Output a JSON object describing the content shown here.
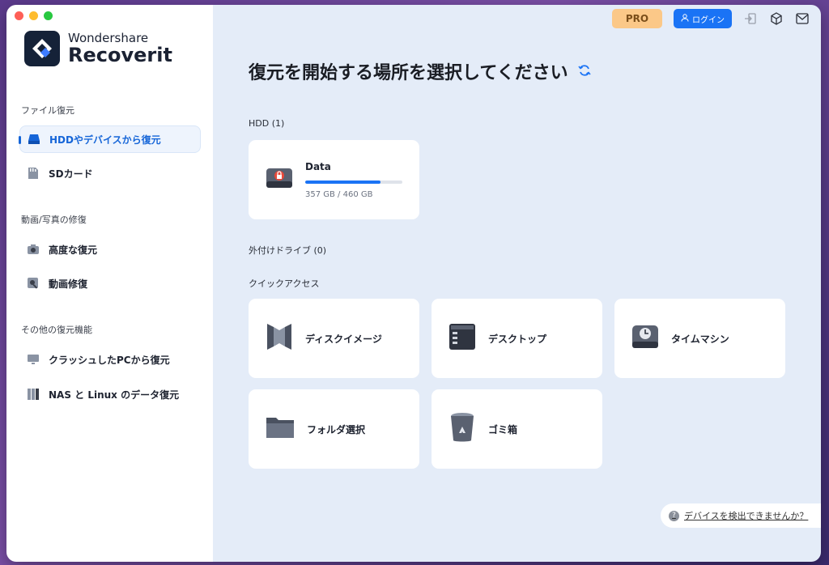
{
  "brand": {
    "line1": "Wondershare",
    "line2": "Recoverit"
  },
  "sidebar": {
    "sections": [
      {
        "title": "ファイル復元"
      },
      {
        "title": "動画/写真の修復"
      },
      {
        "title": "その他の復元機能"
      }
    ],
    "items": [
      {
        "label": "HDDやデバイスから復元",
        "icon": "hdd-icon",
        "active": true
      },
      {
        "label": "SDカード",
        "icon": "sd-card-icon"
      },
      {
        "label": "高度な復元",
        "icon": "camera-icon"
      },
      {
        "label": "動画修復",
        "icon": "video-repair-icon"
      },
      {
        "label": "クラッシュしたPCから復元",
        "icon": "monitor-icon"
      },
      {
        "label": "NAS と Linux のデータ復元",
        "icon": "nas-icon"
      }
    ]
  },
  "topbar": {
    "pro_label": "PRO",
    "login_label": "ログイン"
  },
  "main": {
    "title": "復元を開始する場所を選択してください",
    "hdd_label": "HDD (1)",
    "drive": {
      "name": "Data",
      "used_fraction": 0.776,
      "size_text": "357 GB / 460 GB"
    },
    "external_label": "外付けドライブ (0)",
    "quick_label": "クイックアクセス",
    "quick_items": [
      {
        "label": "ディスクイメージ",
        "icon": "disk-image-icon"
      },
      {
        "label": "デスクトップ",
        "icon": "desktop-icon"
      },
      {
        "label": "タイムマシン",
        "icon": "time-machine-icon"
      },
      {
        "label": "フォルダ選択",
        "icon": "folder-icon"
      },
      {
        "label": "ゴミ箱",
        "icon": "trash-icon"
      }
    ],
    "help_text": "デバイスを検出できませんか？"
  },
  "colors": {
    "accent": "#1a73f5",
    "pro": "#fbc888",
    "main_bg": "#e4ecf8"
  }
}
